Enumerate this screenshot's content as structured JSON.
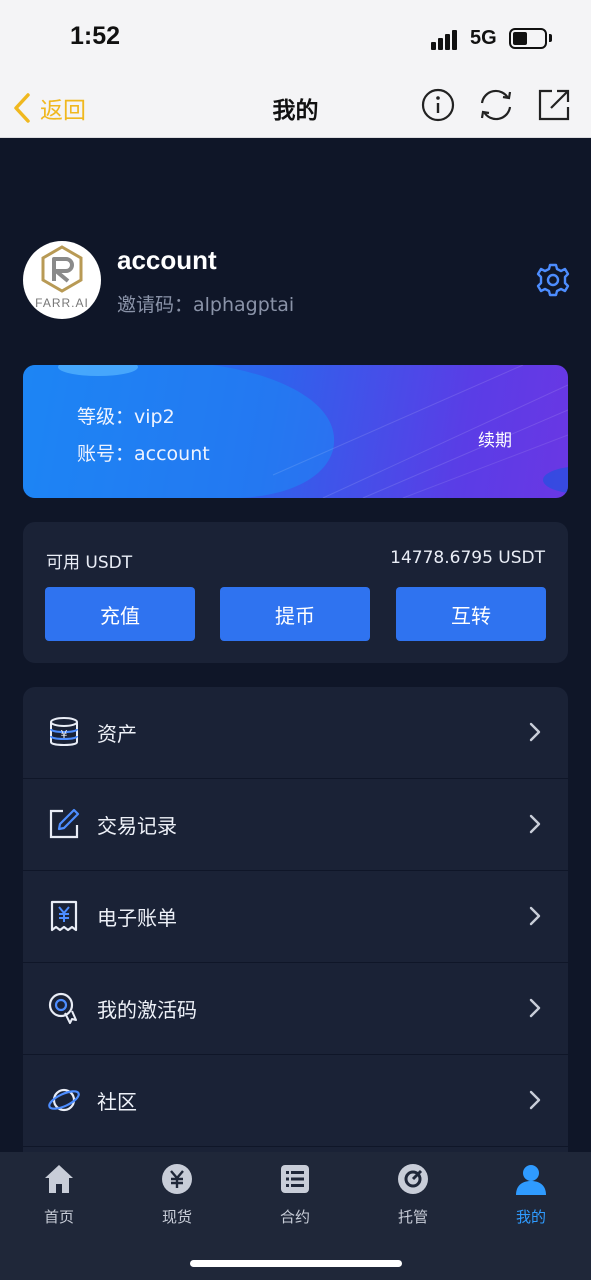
{
  "status_bar": {
    "time": "1:52",
    "network": "5G"
  },
  "nav": {
    "back_label": "返回",
    "title": "我的",
    "icons": [
      "info-icon",
      "refresh-icon",
      "share-icon"
    ],
    "back_color": "#f0b81f"
  },
  "profile": {
    "name": "account",
    "invite_label": "邀请码：",
    "invite_code": "alphagptai",
    "invite_text": "邀请码：alphagptai",
    "avatar_logo_text": "FARR.AI"
  },
  "vip": {
    "level_text": "等级：vip2",
    "account_text": "账号：account",
    "renew_label": "续期"
  },
  "balance": {
    "label": "可用 USDT",
    "value": "14778.6795 USDT",
    "buttons": [
      "充值",
      "提币",
      "互转"
    ]
  },
  "menu": {
    "items": [
      {
        "label": "资产",
        "icon": "coins-stack-icon"
      },
      {
        "label": "交易记录",
        "icon": "edit-icon"
      },
      {
        "label": "电子账单",
        "icon": "receipt-icon"
      },
      {
        "label": "我的激活码",
        "icon": "activation-code-icon"
      },
      {
        "label": "社区",
        "icon": "planet-icon"
      }
    ]
  },
  "tabs": {
    "items": [
      {
        "label": "首页",
        "icon": "home-icon",
        "active": false
      },
      {
        "label": "现货",
        "icon": "yen-coin-icon",
        "active": false
      },
      {
        "label": "合约",
        "icon": "list-icon",
        "active": false
      },
      {
        "label": "托管",
        "icon": "custody-icon",
        "active": false
      },
      {
        "label": "我的",
        "icon": "user-icon",
        "active": true
      }
    ],
    "active_color": "#2f9bff"
  },
  "colors": {
    "background": "#0f1628",
    "card": "#1a2236",
    "button": "#2f73f0",
    "tab_bar": "#1f2739"
  }
}
